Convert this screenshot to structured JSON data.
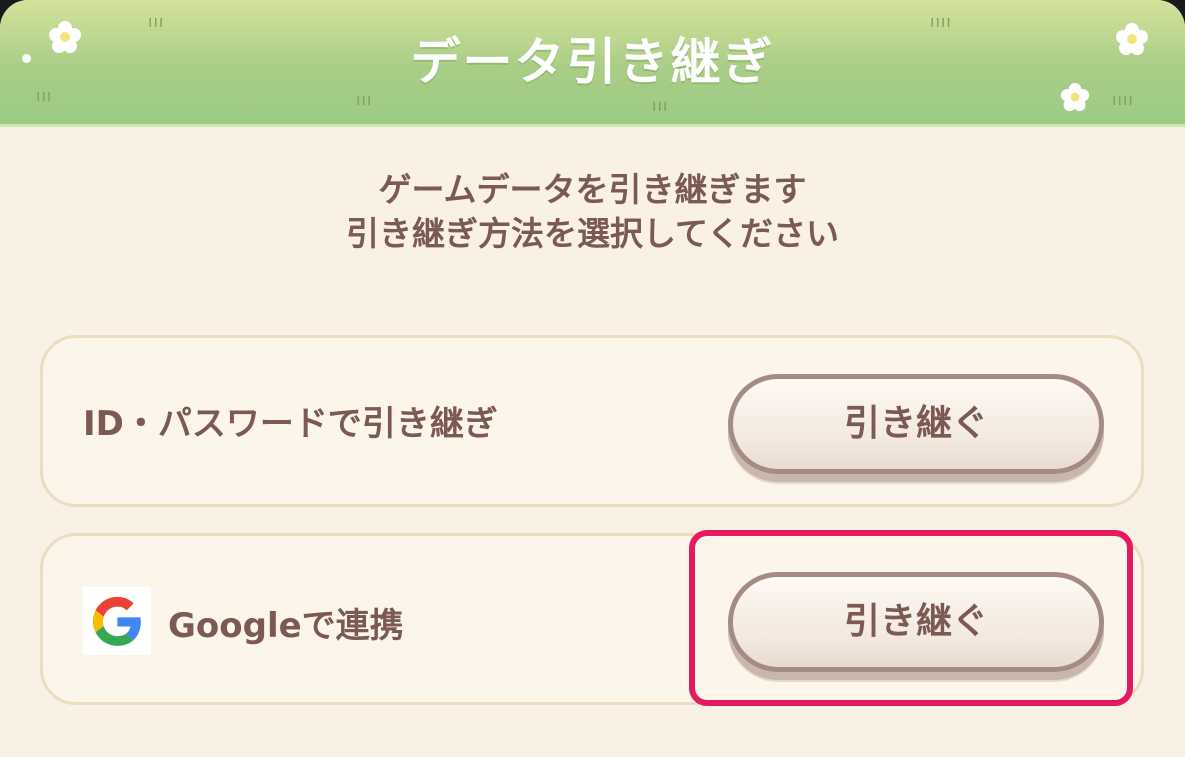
{
  "dialog": {
    "title": "データ引き継ぎ",
    "message_line1": "ゲームデータを引き継ぎます",
    "message_line2": "引き継ぎ方法を選択してください"
  },
  "options": [
    {
      "label": "ID・パスワードで引き継ぎ",
      "button_label": "引き継ぐ",
      "icon": "none"
    },
    {
      "label": "Googleで連携",
      "button_label": "引き継ぐ",
      "icon": "google-logo-icon"
    }
  ],
  "highlight": {
    "target": "google-transfer-button",
    "color": "#e5195f"
  },
  "colors": {
    "header_green": "#a9cd87",
    "panel_cream": "#f9f1e3",
    "text_brown": "#7a5a52"
  }
}
